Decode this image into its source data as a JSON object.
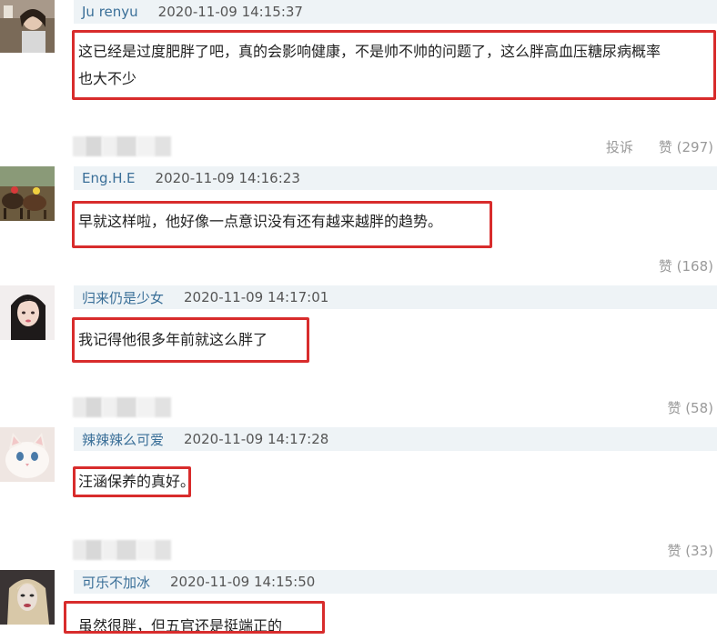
{
  "comments": [
    {
      "username": "Ju renyu",
      "timestamp": "2020-11-09 14:15:37",
      "line1": "这已经是过度肥胖了吧，真的会影响健康，不是帅不帅的问题了，这么胖高血压糖尿病概率",
      "line2": "也大不少",
      "report_label": "投诉",
      "like_label": "赞 (297)",
      "avatar_icon": "girl-portrait-avatar"
    },
    {
      "username": "Eng.H.E",
      "timestamp": "2020-11-09 14:16:23",
      "line1": "早就这样啦，他好像一点意识没有还有越来越胖的趋势。",
      "like_label": "赞 (168)",
      "avatar_icon": "horse-race-avatar"
    },
    {
      "username": "归来仍是少女",
      "timestamp": "2020-11-09 14:17:01",
      "line1": "我记得他很多年前就这么胖了",
      "like_label": "赞 (58)",
      "avatar_icon": "woman-portrait-avatar"
    },
    {
      "username": "辣辣辣么可爱",
      "timestamp": "2020-11-09 14:17:28",
      "line1": "汪涵保养的真好。",
      "like_label": "赞 (33)",
      "avatar_icon": "cat-avatar"
    },
    {
      "username": "可乐不加冰",
      "timestamp": "2020-11-09 14:15:50",
      "line1": "虽然很胖，但五官还是挺端正的",
      "avatar_icon": "blonde-woman-avatar"
    }
  ],
  "colors": {
    "highlight": "#d82c2c",
    "username": "#3a6f98",
    "header_bg": "#eef3f6",
    "action_text": "#9a9a9a"
  }
}
